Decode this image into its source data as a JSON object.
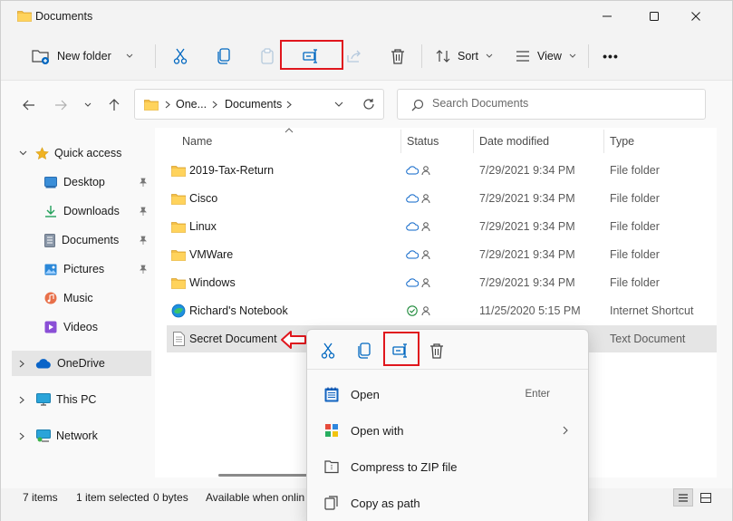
{
  "window": {
    "title": "Documents"
  },
  "toolbar": {
    "new_folder": "New folder",
    "sort": "Sort",
    "view": "View",
    "more": "•••"
  },
  "address": {
    "crumb1": "One...",
    "crumb2": "Documents"
  },
  "search": {
    "placeholder": "Search Documents"
  },
  "sidebar": {
    "quick_access": "Quick access",
    "desktop": "Desktop",
    "downloads": "Downloads",
    "documents": "Documents",
    "pictures": "Pictures",
    "music": "Music",
    "videos": "Videos",
    "onedrive": "OneDrive",
    "this_pc": "This PC",
    "network": "Network"
  },
  "columns": {
    "name": "Name",
    "status": "Status",
    "date": "Date modified",
    "type": "Type"
  },
  "files": [
    {
      "name": "2019-Tax-Return",
      "date": "7/29/2021 9:34 PM",
      "type": "File folder"
    },
    {
      "name": "Cisco",
      "date": "7/29/2021 9:34 PM",
      "type": "File folder"
    },
    {
      "name": "Linux",
      "date": "7/29/2021 9:34 PM",
      "type": "File folder"
    },
    {
      "name": "VMWare",
      "date": "7/29/2021 9:34 PM",
      "type": "File folder"
    },
    {
      "name": "Windows",
      "date": "7/29/2021 9:34 PM",
      "type": "File folder"
    },
    {
      "name": "Richard's Notebook",
      "date": "11/25/2020 5:15 PM",
      "type": "Internet Shortcut"
    },
    {
      "name": "Secret Document",
      "date": "",
      "type": "Text Document"
    }
  ],
  "statusbar": {
    "items": "7 items",
    "selected": "1 item selected",
    "size": "0 bytes",
    "availability": "Available when onlin"
  },
  "context_menu": {
    "open": "Open",
    "open_shortcut": "Enter",
    "open_with": "Open with",
    "compress": "Compress to ZIP file",
    "copy_path": "Copy as path"
  },
  "colors": {
    "accent": "#0067c0",
    "highlight": "#e0161d",
    "folder": "#f4c048"
  }
}
